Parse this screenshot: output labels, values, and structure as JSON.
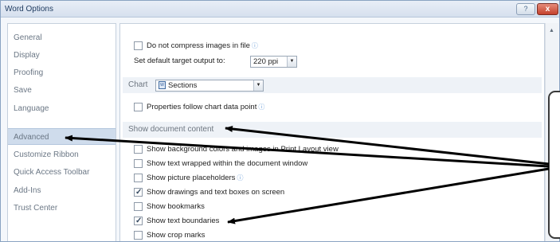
{
  "window": {
    "title": "Word Options",
    "help_label": "?",
    "close_label": "x"
  },
  "nav": {
    "items": [
      {
        "label": "General"
      },
      {
        "label": "Display"
      },
      {
        "label": "Proofing"
      },
      {
        "label": "Save"
      },
      {
        "label": "Language"
      },
      {
        "label": "Advanced",
        "selected": true
      },
      {
        "label": "Customize Ribbon"
      },
      {
        "label": "Quick Access Toolbar"
      },
      {
        "label": "Add-Ins"
      },
      {
        "label": "Trust Center"
      }
    ]
  },
  "image_options": {
    "do_not_compress_label": "Do not compress images in file",
    "do_not_compress_checked": false,
    "target_output_label": "Set default target output to:",
    "target_output_value": "220 ppi"
  },
  "chart": {
    "label": "Chart",
    "selected_value": "Sections",
    "properties_follow_label": "Properties follow chart data point",
    "properties_follow_checked": false
  },
  "show_document_content": {
    "header": "Show document content",
    "options": [
      {
        "label": "Show background colors and images in Print Layout view",
        "checked": false
      },
      {
        "label": "Show text wrapped within the document window",
        "checked": false
      },
      {
        "label": "Show picture placeholders",
        "checked": false,
        "info": true
      },
      {
        "label": "Show drawings and text boxes on screen",
        "checked": true
      },
      {
        "label": "Show bookmarks",
        "checked": false
      },
      {
        "label": "Show text boundaries",
        "checked": true
      },
      {
        "label": "Show crop marks",
        "checked": false
      }
    ]
  },
  "icons": {
    "info": "info-icon",
    "chart_type": "document-icon",
    "dropdown": "chevron-down-icon",
    "scroll_up": "arrow-up-icon"
  },
  "colors": {
    "selected_nav_bg": "#cfdcec",
    "section_header_bg": "#eef2f7",
    "arrow": "#000000"
  }
}
